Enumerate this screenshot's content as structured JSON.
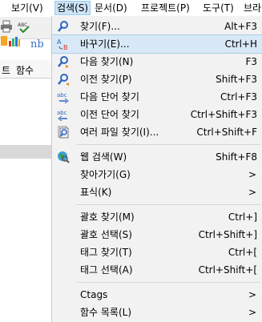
{
  "menubar": {
    "items": [
      {
        "label": "보기(V)"
      },
      {
        "label": "검색(S)"
      },
      {
        "label": "문서(D)"
      },
      {
        "label": "프로젝트(P)"
      },
      {
        "label": "도구(T)"
      },
      {
        "label": "브라"
      }
    ]
  },
  "app": {
    "toolbar_icons": [
      "print-icon",
      "spellcheck-icon",
      "color-grid-icon",
      "bold-icon"
    ],
    "toolbar_text": "nb",
    "tabs": [
      "트",
      "함수"
    ]
  },
  "search_menu": {
    "items": [
      {
        "label": "찾기(F)...",
        "shortcut": "Alt+F3",
        "icon": "search-icon"
      },
      {
        "label": "바꾸기(E)...",
        "shortcut": "Ctrl+H",
        "icon": "replace-icon"
      },
      {
        "label": "다음 찾기(N)",
        "shortcut": "F3",
        "icon": "find-next-icon"
      },
      {
        "label": "이전 찾기(P)",
        "shortcut": "Shift+F3",
        "icon": "find-previous-icon"
      },
      {
        "label": "다음 단어 찾기",
        "shortcut": "Ctrl+F3",
        "icon": "find-next-word-icon"
      },
      {
        "label": "이전 단어 찾기",
        "shortcut": "Ctrl+Shift+F3",
        "icon": "find-previous-word-icon"
      },
      {
        "label": "여러 파일 찾기(I)...",
        "shortcut": "Ctrl+Shift+F",
        "icon": "find-in-files-icon"
      },
      {
        "label": "웹 검색(W)",
        "shortcut": "Shift+F8",
        "icon": "web-search-icon"
      },
      {
        "label": "찾아가기(G)",
        "shortcut": "",
        "icon": ""
      },
      {
        "label": "표식(K)",
        "shortcut": "",
        "icon": ""
      },
      {
        "label": "괄호 찾기(M)",
        "shortcut": "Ctrl+]",
        "icon": ""
      },
      {
        "label": "괄호 선택(S)",
        "shortcut": "Ctrl+Shift+]",
        "icon": ""
      },
      {
        "label": "태그 찾기(T)",
        "shortcut": "Ctrl+[",
        "icon": ""
      },
      {
        "label": "태그 선택(A)",
        "shortcut": "Ctrl+Shift+[",
        "icon": ""
      },
      {
        "label": "Ctags",
        "shortcut": "",
        "icon": ""
      },
      {
        "label": "함수 목록(L)",
        "shortcut": "",
        "icon": ""
      }
    ],
    "submenu_arrow": ">"
  },
  "colors": {
    "menu_bg": "#f2f2f2",
    "highlight": "#d8e8f6",
    "active_menu": "#cce4f7"
  }
}
